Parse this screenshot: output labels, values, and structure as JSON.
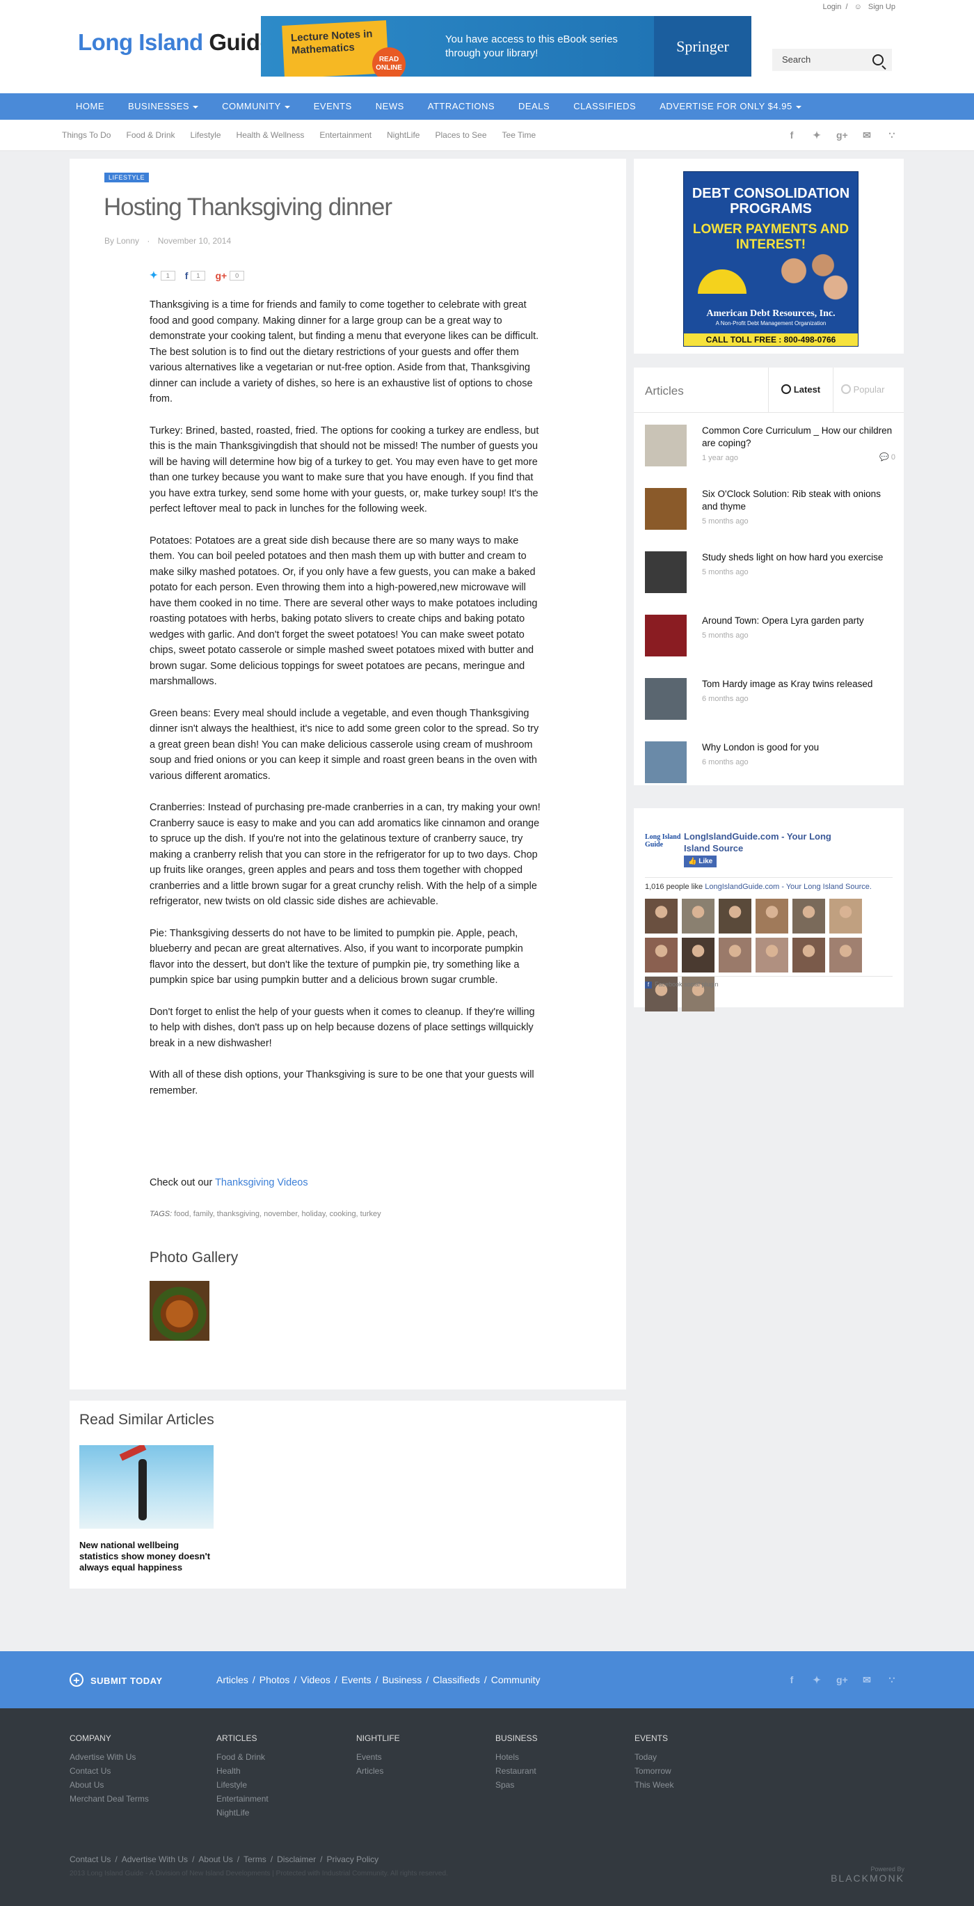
{
  "header": {
    "logo_part1": "Long Island",
    "logo_part2": "Guide",
    "login": "Login",
    "separator": "/",
    "signup": "Sign Up",
    "search_placeholder": "Search"
  },
  "banner": {
    "book_title": "Lecture Notes in Mathematics",
    "badge": "READ ONLINE",
    "message": "You have access to this eBook series through your library!",
    "brand": "Springer"
  },
  "main_nav": [
    {
      "label": "HOME",
      "dropdown": false
    },
    {
      "label": "BUSINESSES",
      "dropdown": true
    },
    {
      "label": "COMMUNITY",
      "dropdown": true
    },
    {
      "label": "EVENTS",
      "dropdown": false
    },
    {
      "label": "NEWS",
      "dropdown": false
    },
    {
      "label": "ATTRACTIONS",
      "dropdown": false
    },
    {
      "label": "DEALS",
      "dropdown": false
    },
    {
      "label": "CLASSIFIEDS",
      "dropdown": false
    },
    {
      "label": "ADVERTISE FOR ONLY $4.95",
      "dropdown": true
    }
  ],
  "sub_nav": [
    "Things To Do",
    "Food & Drink",
    "Lifestyle",
    "Health & Wellness",
    "Entertainment",
    "NightLife",
    "Places to See",
    "Tee Time"
  ],
  "social_icons": [
    "facebook-icon",
    "twitter-icon",
    "google-plus-icon",
    "email-icon",
    "rss-icon"
  ],
  "article": {
    "category": "LIFESTYLE",
    "title": "Hosting Thanksgiving dinner",
    "author": "By Lonny",
    "date": "November 10, 2014",
    "share": {
      "twitter": "1",
      "facebook": "1",
      "google": "0"
    },
    "paragraphs": [
      "Thanksgiving is a time for friends and family to come together to celebrate with great food and good company.  Making dinner for a large group can be a great way to demonstrate your cooking talent, but finding a menu that everyone likes can be difficult.  The best solution is to find out the dietary restrictions of your guests and offer them various alternatives like a vegetarian or nut-free option. Aside from that, Thanksgiving dinner can include a variety of dishes, so here is an exhaustive list of options to chose from.",
      "Turkey: Brined, basted, roasted, fried.  The options for cooking a turkey are endless, but this is the main Thanksgivingdish that should not be missed!  The number of guests you will be having will determine how big of a turkey to get.  You may even have to get more than one turkey because you want to make sure that you have enough.  If you find that you have extra turkey, send some home with your guests, or, make turkey soup! It's the perfect leftover meal to pack in lunches for the following week.",
      "Potatoes:  Potatoes are a great side dish because there are so many ways to make them.  You can boil peeled potatoes and then mash them up with butter and cream to make silky mashed potatoes.  Or, if you only have a few guests, you can make a baked potato for each person.  Even throwing them into a high-powered,new microwave will have them cooked in no time. There are several other ways to make potatoes including roasting potatoes with herbs, baking potato slivers to create chips and baking potato wedges with garlic.  And don't forget the sweet potatoes! You can make sweet potato chips, sweet potato casserole or simple mashed sweet potatoes mixed with butter and brown sugar.  Some delicious toppings for sweet potatoes are pecans, meringue and marshmallows.",
      "Green beans:  Every meal should include a vegetable, and even though Thanksgiving dinner isn't always the healthiest, it's nice to add some green color to the spread.  So try a great green bean dish! You can make delicious casserole using cream of mushroom soup and fried onions or you can keep it simple and roast green beans in the oven with various different aromatics.",
      "Cranberries:  Instead of purchasing pre-made cranberries in a can, try making your own!  Cranberry sauce is easy to make and you can add aromatics like cinnamon and orange to spruce up the dish.  If you're not into the gelatinous texture of cranberry sauce, try making a cranberry relish that you can store in the refrigerator for up to two days.  Chop up fruits like oranges, green apples and pears and toss them together with chopped cranberries and a little brown sugar for a great crunchy relish.  With the help of a simple refrigerator, new twists on old classic side dishes are achievable.",
      "Pie:  Thanksgiving desserts do not have to be limited to pumpkin pie.  Apple, peach, blueberry and pecan are great alternatives.  Also, if you want to incorporate pumpkin flavor into the dessert, but don't like the texture of pumpkin pie, try something like a pumpkin spice bar using pumpkin butter and a delicious brown sugar crumble.",
      "Don't forget to enlist the help of your guests when it comes to cleanup.  If they're willing to help with dishes, don't pass up on help because dozens of place settings willquickly break in a new dishwasher!",
      "With all of these dish options, your Thanksgiving is sure to be one that your guests will remember."
    ],
    "checkout_prefix": "Check out our",
    "checkout_link": "Thanksgiving Videos",
    "tags_label": "TAGS:",
    "tags": "food, family, thanksgiving, november, holiday, cooking, turkey",
    "gallery_title": "Photo Gallery"
  },
  "similar": {
    "heading": "Read Similar Articles",
    "title": "New national wellbeing statistics show money doesn't always equal happiness"
  },
  "sidebar_ad": {
    "line1": "DEBT CONSOLIDATION PROGRAMS",
    "line2": "LOWER PAYMENTS AND INTEREST!",
    "company": "American Debt Resources, Inc.",
    "subtitle": "A Non-Profit Debt Management Organization",
    "phone": "CALL TOLL FREE : 800-498-0766"
  },
  "articles_widget": {
    "heading": "Articles",
    "tab_latest": "Latest",
    "tab_popular": "Popular",
    "items": [
      {
        "title": "Common Core Curriculum _ How our children are coping?",
        "time": "1 year ago",
        "comments": "0",
        "color": "#c9c3b6"
      },
      {
        "title": "Six O'Clock Solution: Rib steak with onions and thyme",
        "time": "5 months ago",
        "comments": "",
        "color": "#8a5a2a"
      },
      {
        "title": "Study sheds light on how hard you exercise",
        "time": "5 months ago",
        "comments": "",
        "color": "#3a3a3a"
      },
      {
        "title": "Around Town: Opera Lyra garden party",
        "time": "5 months ago",
        "comments": "",
        "color": "#8a1c22"
      },
      {
        "title": "Tom Hardy image as Kray twins released",
        "time": "6 months ago",
        "comments": "",
        "color": "#5a6670"
      },
      {
        "title": "Why London is good for you",
        "time": "6 months ago",
        "comments": "",
        "color": "#6a8aa8"
      }
    ]
  },
  "facebook_widget": {
    "logo_text": "Long Island Guide",
    "page_name": "LongIslandGuide.com - Your Long Island Source",
    "like": "Like",
    "count_prefix": "1,016 people like",
    "count_link": "LongIslandGuide.com - Your Long Island Source.",
    "plugin_label": "Facebook social plugin",
    "face_colors": [
      "#6a5040",
      "#8a8070",
      "#5a4a3a",
      "#a07a5a",
      "#7a6a5a",
      "#c0a080",
      "#8a6050",
      "#4a3a30",
      "#9a7a6a",
      "#b09080",
      "#7a5a4a",
      "#a08070",
      "#6a5a50",
      "#8a7a6a"
    ]
  },
  "footer": {
    "submit": "SUBMIT TODAY",
    "links": [
      "Articles",
      "Photos",
      "Videos",
      "Events",
      "Business",
      "Classifieds",
      "Community"
    ],
    "columns": [
      {
        "heading": "COMPANY",
        "items": [
          "Advertise With Us",
          "Contact Us",
          "About Us",
          "Merchant Deal Terms"
        ]
      },
      {
        "heading": "ARTICLES",
        "items": [
          "Food & Drink",
          "Health",
          "Lifestyle",
          "Entertainment",
          "NightLife"
        ]
      },
      {
        "heading": "NIGHTLIFE",
        "items": [
          "Events",
          "Articles"
        ]
      },
      {
        "heading": "BUSINESS",
        "items": [
          "Hotels",
          "Restaurant",
          "Spas"
        ]
      },
      {
        "heading": "EVENTS",
        "items": [
          "Today",
          "Tomorrow",
          "This Week"
        ]
      }
    ],
    "bottom_links": [
      "Contact Us",
      "Advertise With Us",
      "About Us",
      "Terms",
      "Disclaimer",
      "Privacy Policy"
    ],
    "copyright": "2013 Long Island Guide - A Division of New Island Developments  |  Protected with Industrial Community. All rights reserved.",
    "powered_by": "Powered By",
    "powered_brand": "BLACKMONK"
  }
}
